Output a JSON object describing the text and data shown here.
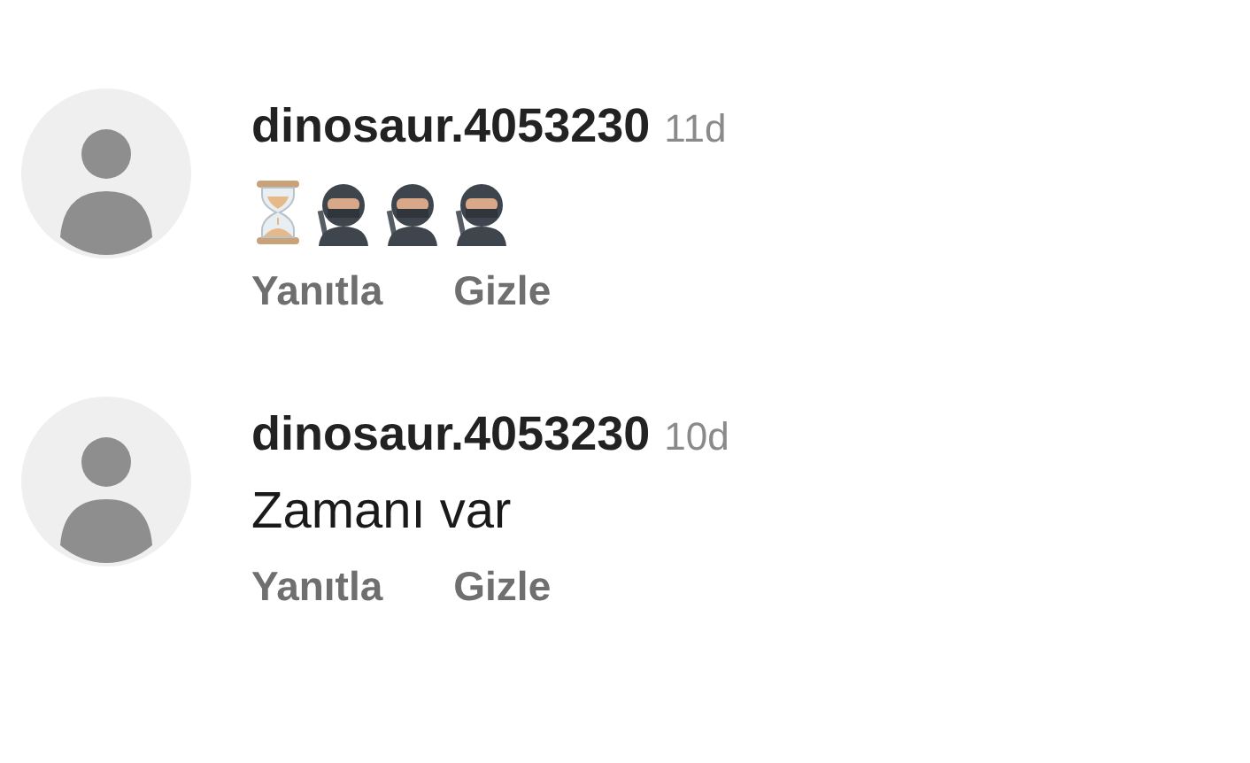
{
  "comments": [
    {
      "username": "dinosaur.4053230",
      "time": "11d",
      "body": {
        "kind": "emoji",
        "emojis": [
          {
            "kind": "hourglass"
          },
          {
            "kind": "ninja"
          },
          {
            "kind": "ninja"
          },
          {
            "kind": "ninja"
          }
        ]
      },
      "actions": [
        "Yanıtla",
        "Gizle"
      ]
    },
    {
      "username": "dinosaur.4053230",
      "time": "10d",
      "body": {
        "kind": "text",
        "text": "Zamanı var"
      },
      "actions": [
        "Yanıtla",
        "Gizle"
      ]
    }
  ]
}
